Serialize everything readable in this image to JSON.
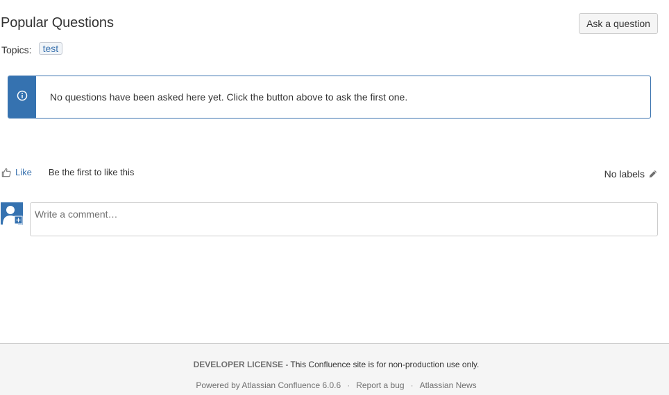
{
  "header": {
    "title": "Popular Questions",
    "ask_button": "Ask a question"
  },
  "topics": {
    "label": "Topics:",
    "tags": [
      "test"
    ]
  },
  "info": {
    "icon": "info-icon",
    "message": "No questions have been asked here yet. Click the button above to ask the first one."
  },
  "likes": {
    "like_label": "Like",
    "description": "Be the first to like this"
  },
  "labels": {
    "text": "No labels",
    "edit_icon": "pencil-icon"
  },
  "comment": {
    "placeholder": "Write a comment…"
  },
  "footer": {
    "license_strong": "DEVELOPER LICENSE",
    "license_rest": " - This Confluence site is for non-production use only.",
    "links": [
      "Powered by Atlassian Confluence 6.0.6",
      "Report a bug",
      "Atlassian News"
    ],
    "separator": "·"
  },
  "colors": {
    "accent": "#3572b0",
    "link": "#3b73af",
    "footer_bg": "#f5f5f5"
  }
}
